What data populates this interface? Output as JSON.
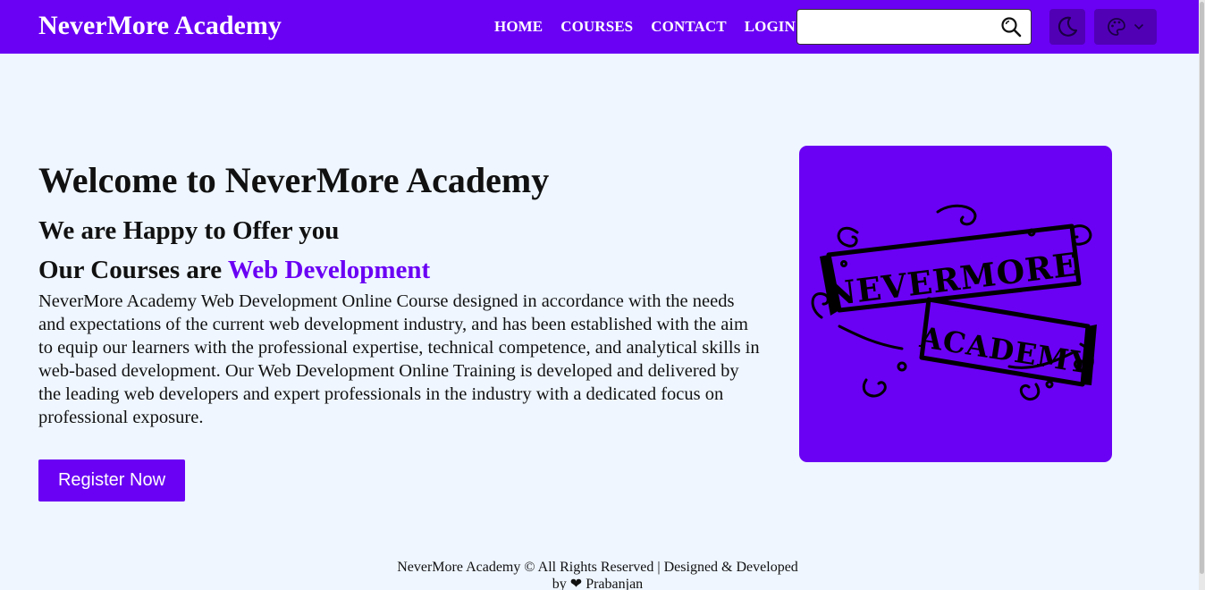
{
  "brand": "NeverMore Academy",
  "nav": {
    "home": "HOME",
    "courses": "COURSES",
    "contact": "CONTACT",
    "login": "LOGIN"
  },
  "search": {
    "placeholder": "",
    "value": ""
  },
  "icons": {
    "search": "search-icon",
    "theme": "moon-icon",
    "palette": "palette-icon",
    "dropdown": "chevron-down-icon"
  },
  "hero": {
    "title": "Welcome to NeverMore Academy",
    "subtitle": "We are Happy to Offer you",
    "courses_prefix": "Our Courses are",
    "courses_highlight": "Web Development",
    "description": "NeverMore Academy Web Development Online Course designed in accordance with the needs and expectations of the current web development industry, and has been established with the aim to equip our learners with the professional expertise, technical competence, and analytical skills in web-based development. Our Web Development Online Training is developed and delivered by the leading web developers and expert professionals in the industry with a dedicated focus on professional exposure.",
    "register_label": "Register Now"
  },
  "logo": {
    "line1": "NEVERMORE",
    "line2": "ACADEMY"
  },
  "footer": {
    "line1": "NeverMore Academy © All Rights Reserved | Designed & Developed",
    "line2": "by ❤ Prabanjan"
  },
  "colors": {
    "primary": "#6a00f4",
    "primary_dark": "#5100b6",
    "background": "#eff6ff"
  }
}
